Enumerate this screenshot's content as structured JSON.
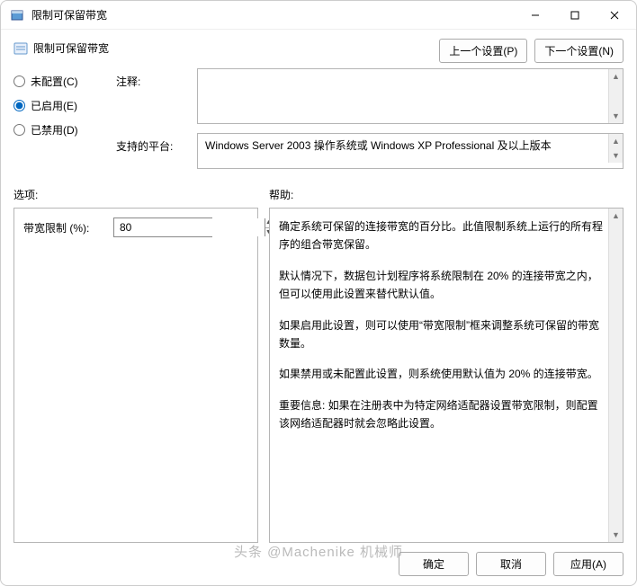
{
  "window": {
    "title": "限制可保留带宽"
  },
  "header": {
    "title": "限制可保留带宽",
    "prev_btn": "上一个设置(P)",
    "next_btn": "下一个设置(N)"
  },
  "radios": {
    "not_configured": "未配置(C)",
    "enabled": "已启用(E)",
    "disabled": "已禁用(D)",
    "selected": "enabled"
  },
  "fields": {
    "comment_label": "注释:",
    "comment_value": "",
    "platform_label": "支持的平台:",
    "platform_value": "Windows Server 2003 操作系统或 Windows XP Professional 及以上版本"
  },
  "labels": {
    "options": "选项:",
    "help": "帮助:"
  },
  "options": {
    "bandwidth_label": "带宽限制 (%):",
    "bandwidth_value": "80"
  },
  "help": {
    "p1": "确定系统可保留的连接带宽的百分比。此值限制系统上运行的所有程序的组合带宽保留。",
    "p2": "默认情况下，数据包计划程序将系统限制在 20% 的连接带宽之内，但可以使用此设置来替代默认值。",
    "p3": "如果启用此设置，则可以使用“带宽限制”框来调整系统可保留的带宽数量。",
    "p4": "如果禁用或未配置此设置，则系统使用默认值为 20% 的连接带宽。",
    "p5": "重要信息: 如果在注册表中为特定网络适配器设置带宽限制，则配置该网络适配器时就会忽略此设置。"
  },
  "footer": {
    "ok": "确定",
    "cancel": "取消",
    "apply": "应用(A)"
  },
  "watermark": "头条 @Machenike 机械师"
}
